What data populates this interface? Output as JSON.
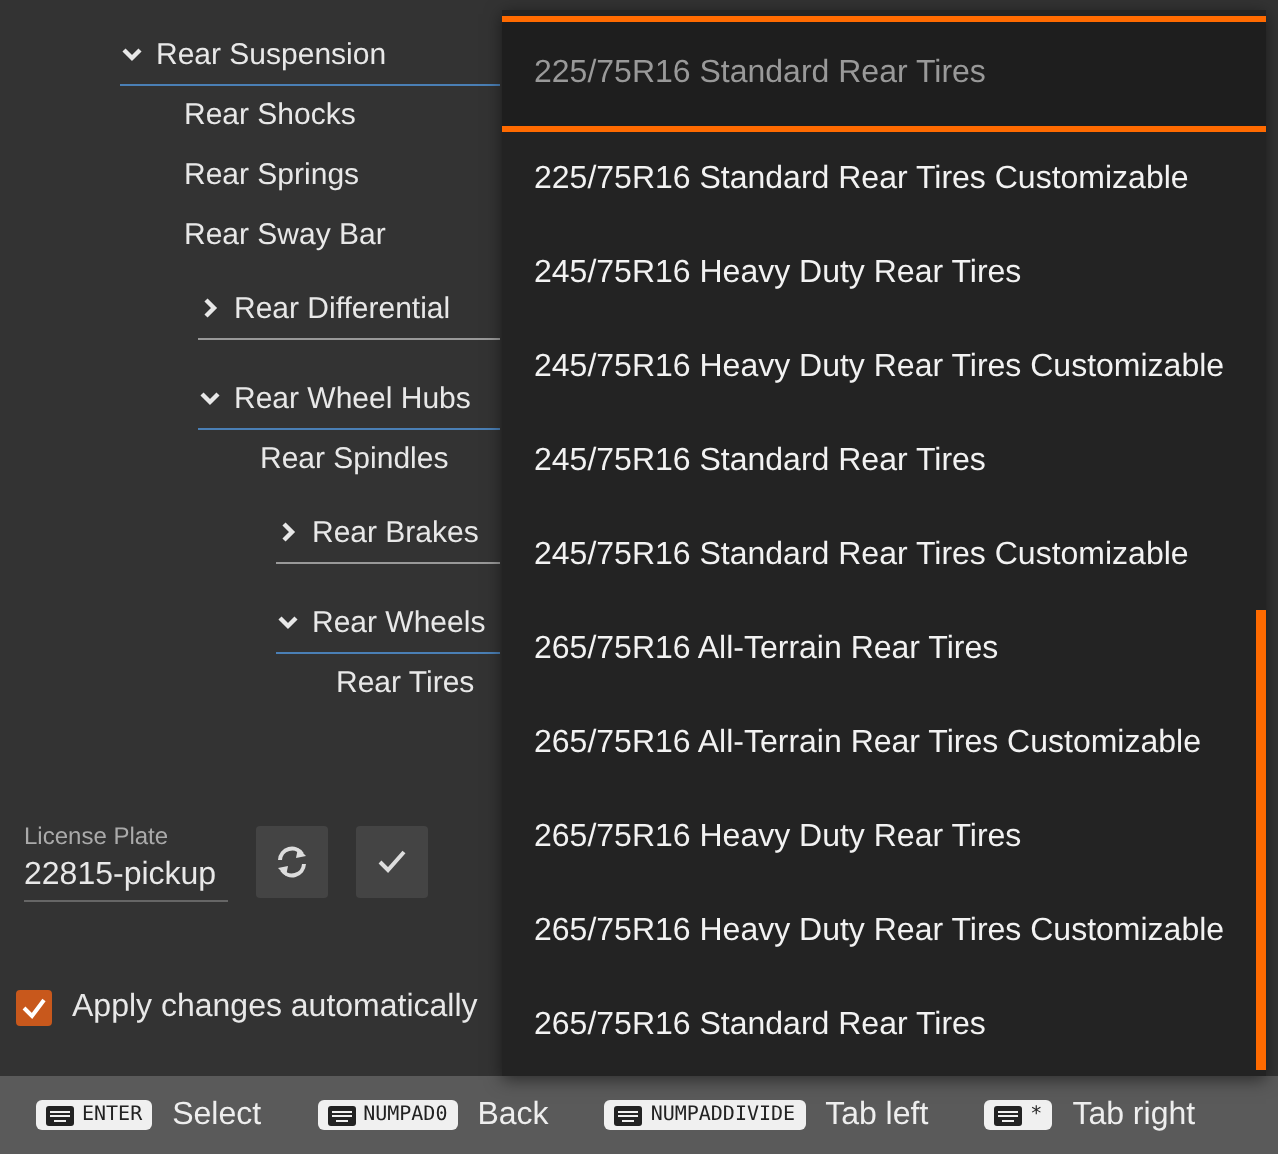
{
  "tree": [
    {
      "label": "Rear Suspension",
      "expanded": true,
      "children": [
        {
          "label": "Rear Shocks"
        },
        {
          "label": "Rear Springs"
        },
        {
          "label": "Rear Sway Bar"
        },
        {
          "label": "Rear Differential",
          "kind": "group",
          "expanded": false
        },
        {
          "label": "Rear Wheel Hubs",
          "expanded": true,
          "children": [
            {
              "label": "Rear Spindles"
            },
            {
              "label": "Rear Brakes",
              "kind": "group",
              "expanded": false
            },
            {
              "label": "Rear Wheels",
              "expanded": true,
              "children": [
                {
                  "label": "Rear Tires"
                }
              ]
            }
          ]
        }
      ]
    }
  ],
  "license_plate": {
    "label": "License Plate",
    "value": "22815-pickup"
  },
  "apply_changes": {
    "label": "Apply changes automatically",
    "checked": true
  },
  "dropdown": {
    "value": "225/75R16 Standard Rear Tires",
    "options": [
      {
        "label": "225/75R16 Standard Rear Tires Customizable",
        "selected": false
      },
      {
        "label": "245/75R16 Heavy Duty Rear Tires",
        "selected": false
      },
      {
        "label": "245/75R16 Heavy Duty Rear Tires Customizable",
        "selected": false
      },
      {
        "label": "245/75R16 Standard Rear Tires",
        "selected": false
      },
      {
        "label": "245/75R16 Standard Rear Tires Customizable",
        "selected": false
      },
      {
        "label": "265/75R16 All-Terrain Rear Tires",
        "selected": false
      },
      {
        "label": "265/75R16 All-Terrain Rear Tires Customizable",
        "selected": false
      },
      {
        "label": "265/75R16 Heavy Duty Rear Tires",
        "selected": false
      },
      {
        "label": "265/75R16 Heavy Duty Rear Tires Customizable",
        "selected": false
      },
      {
        "label": "265/75R16 Standard Rear Tires",
        "selected": false
      }
    ]
  },
  "hints": [
    {
      "key": "ENTER",
      "label": "Select"
    },
    {
      "key": "NUMPAD0",
      "label": "Back"
    },
    {
      "key": "NUMPADDIVIDE",
      "label": "Tab left"
    },
    {
      "key": "*",
      "label": "Tab right"
    }
  ]
}
